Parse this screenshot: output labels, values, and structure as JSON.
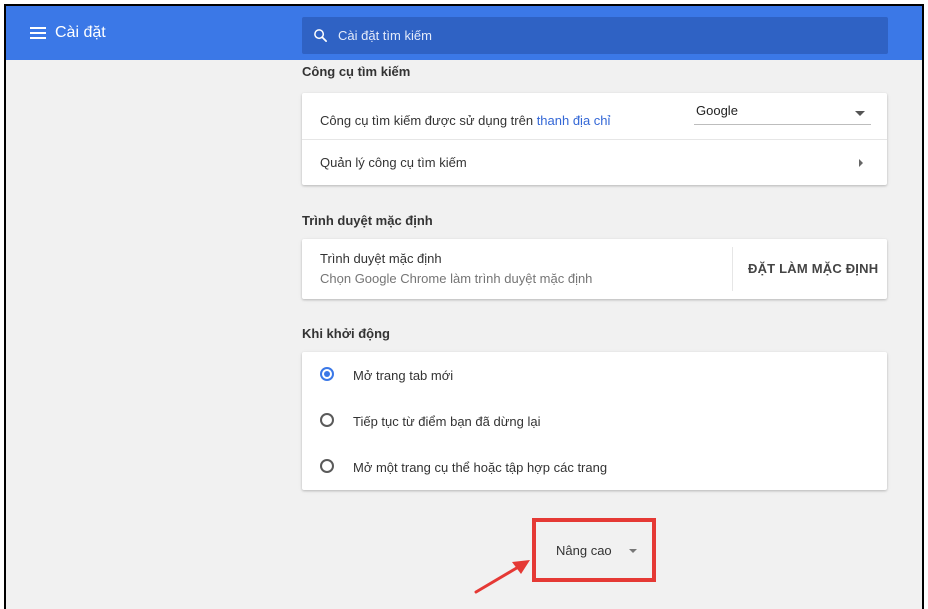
{
  "header": {
    "title": "Cài đặt",
    "search_placeholder": "Cài đặt tìm kiếm"
  },
  "search_engine": {
    "section_title": "Công cụ tìm kiếm",
    "used_label_prefix": "Công cụ tìm kiếm được sử dụng trên ",
    "used_label_link": "thanh địa chỉ",
    "selected_engine": "Google",
    "manage_label": "Quản lý công cụ tìm kiếm"
  },
  "default_browser": {
    "section_title": "Trình duyệt mặc định",
    "label": "Trình duyệt mặc định",
    "sublabel": "Chọn Google Chrome làm trình duyệt mặc định",
    "button_label": "ĐẶT LÀM MẶC ĐỊNH"
  },
  "startup": {
    "section_title": "Khi khởi động",
    "options": [
      {
        "label": "Mở trang tab mới",
        "checked": true
      },
      {
        "label": "Tiếp tục từ điểm bạn đã dừng lại",
        "checked": false
      },
      {
        "label": "Mở một trang cụ thể hoặc tập hợp các trang",
        "checked": false
      }
    ]
  },
  "advanced": {
    "label": "Nâng cao"
  },
  "colors": {
    "header_blue": "#3b78e7",
    "search_blue": "#2f62c4",
    "link_blue": "#3367d6",
    "highlight_red": "#e53935"
  }
}
